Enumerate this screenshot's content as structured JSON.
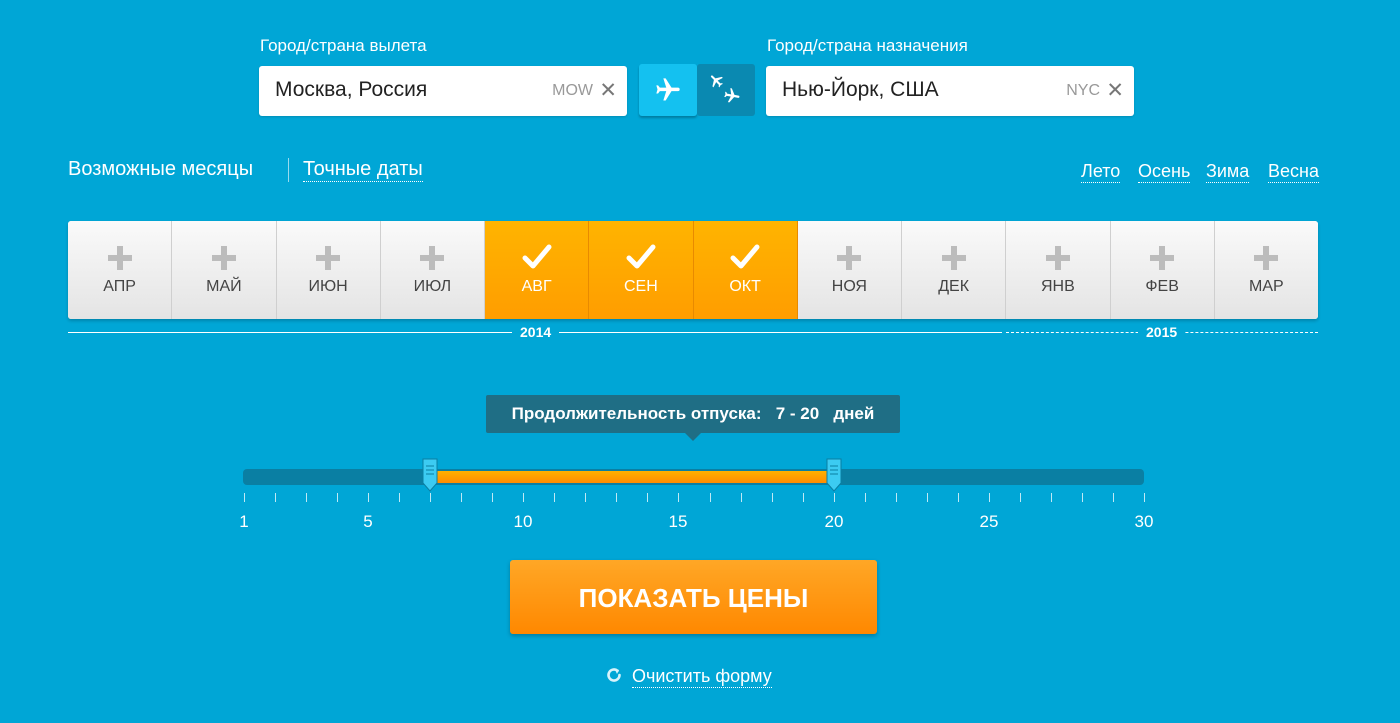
{
  "from": {
    "label": "Город/страна вылета",
    "value": "Москва, Россия",
    "code": "MOW",
    "clear": "✕"
  },
  "to": {
    "label": "Город/страна назначения",
    "value": "Нью-Йорк, США",
    "code": "NYC",
    "clear": "✕"
  },
  "trip_toggle": {
    "selected": "one-way",
    "options": [
      "one-way-icon",
      "round-trip-icon"
    ]
  },
  "date_mode": {
    "active": "Возможные месяцы",
    "inactive": "Точные даты"
  },
  "seasons": [
    "Лето",
    "Осень",
    "Зима",
    "Весна"
  ],
  "months": [
    {
      "label": "АПР",
      "selected": false
    },
    {
      "label": "МАЙ",
      "selected": false
    },
    {
      "label": "ИЮН",
      "selected": false
    },
    {
      "label": "ИЮЛ",
      "selected": false
    },
    {
      "label": "АВГ",
      "selected": true
    },
    {
      "label": "СЕН",
      "selected": true
    },
    {
      "label": "ОКТ",
      "selected": true
    },
    {
      "label": "НОЯ",
      "selected": false
    },
    {
      "label": "ДЕК",
      "selected": false
    },
    {
      "label": "ЯНВ",
      "selected": false
    },
    {
      "label": "ФЕВ",
      "selected": false
    },
    {
      "label": "МАР",
      "selected": false
    }
  ],
  "years": [
    "2014",
    "2015"
  ],
  "duration": {
    "prefix": "Продолжительность отпуска:",
    "range_text": "7 - 20",
    "suffix": "дней",
    "min": 1,
    "max": 30,
    "low": 7,
    "high": 20,
    "tick_labels": [
      "1",
      "5",
      "10",
      "15",
      "20",
      "25",
      "30"
    ]
  },
  "submit_label": "ПОКАЗАТЬ ЦЕНЫ",
  "reset_label": "Очистить форму",
  "colors": {
    "background": "#00a6d6",
    "accent": "#ff9d00",
    "dark": "#1f6e85",
    "toggle_active": "#14c1f0"
  }
}
